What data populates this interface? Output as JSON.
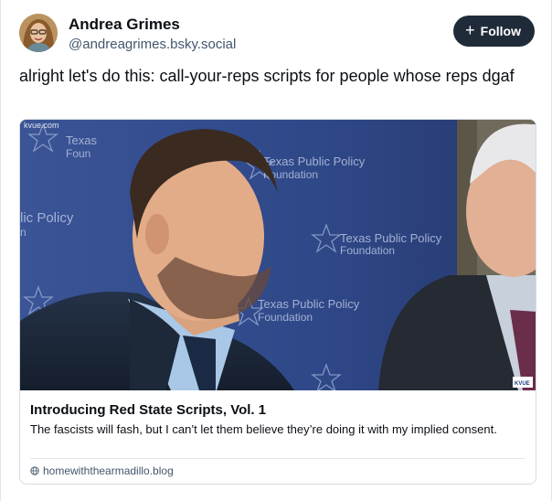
{
  "author": {
    "display_name": "Andrea Grimes",
    "handle": "@andreagrimes.bsky.social",
    "avatar_icon": "profile-photo"
  },
  "follow_button": {
    "icon": "plus-icon",
    "glyph": "+",
    "label": "Follow"
  },
  "post": {
    "text": "alright let's do this: call-your-reps scripts for people whose reps dgaf"
  },
  "link_card": {
    "thumbnail": {
      "watermark": "kvue.com",
      "backdrop_lines": [
        {
          "top": "Texas Public Policy",
          "bottom": "Foundation"
        },
        {
          "top": "Texas Public Policy",
          "bottom": "Foundation"
        },
        {
          "top": "Texas Public Policy",
          "bottom": "Foundation"
        },
        {
          "top": "lic Policy",
          "bottom": "n"
        },
        {
          "top": "Texas",
          "bottom": "Foun"
        }
      ],
      "badge": "KVUE"
    },
    "title": "Introducing Red State Scripts, Vol. 1",
    "description": "The fascists will fash, but I can’t let them believe they’re doing it with my implied consent.",
    "domain": "homewiththearmadillo.blog",
    "domain_icon": "globe-icon"
  },
  "colors": {
    "follow_bg": "#1f2b38",
    "backdrop_blue": "#2f4a8c",
    "handle_gray": "#42576c"
  }
}
